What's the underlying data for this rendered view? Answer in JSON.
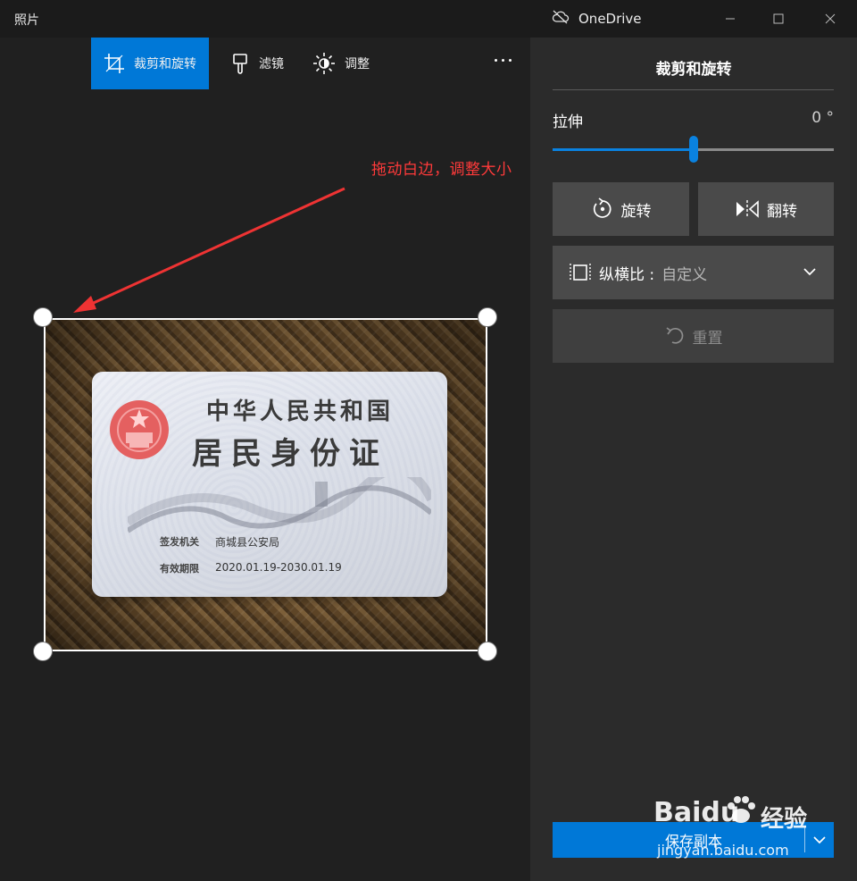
{
  "window": {
    "app_title": "照片",
    "onedrive_label": "OneDrive"
  },
  "toolbar": {
    "crop_rotate_label": "裁剪和旋转",
    "filters_label": "滤镜",
    "adjust_label": "调整"
  },
  "annotation": {
    "text": "拖动白边，调整大小",
    "color": "#ff3a3a"
  },
  "photo": {
    "card_title_line1": "中华人民共和国",
    "card_title_line2": "居民身份证",
    "issuer_label": "签发机关",
    "issuer_value": "商城县公安局",
    "validity_label": "有效期限",
    "validity_value": "2020.01.19-2030.01.19"
  },
  "panel": {
    "title": "裁剪和旋转",
    "stretch_label": "拉伸",
    "stretch_value": "0 °",
    "stretch_level": 0.5,
    "rotate_label": "旋转",
    "flip_label": "翻转",
    "aspect_label": "纵横比 :",
    "aspect_value": "自定义",
    "reset_label": "重置",
    "save_copy_label": "保存副本"
  },
  "watermark": {
    "brand": "Baidu",
    "suffix": "经验",
    "url": "jingyan.baidu.com"
  },
  "colors": {
    "accent": "#0078d7",
    "panel_bg": "#2b2b2b",
    "canvas_bg": "#202020"
  }
}
